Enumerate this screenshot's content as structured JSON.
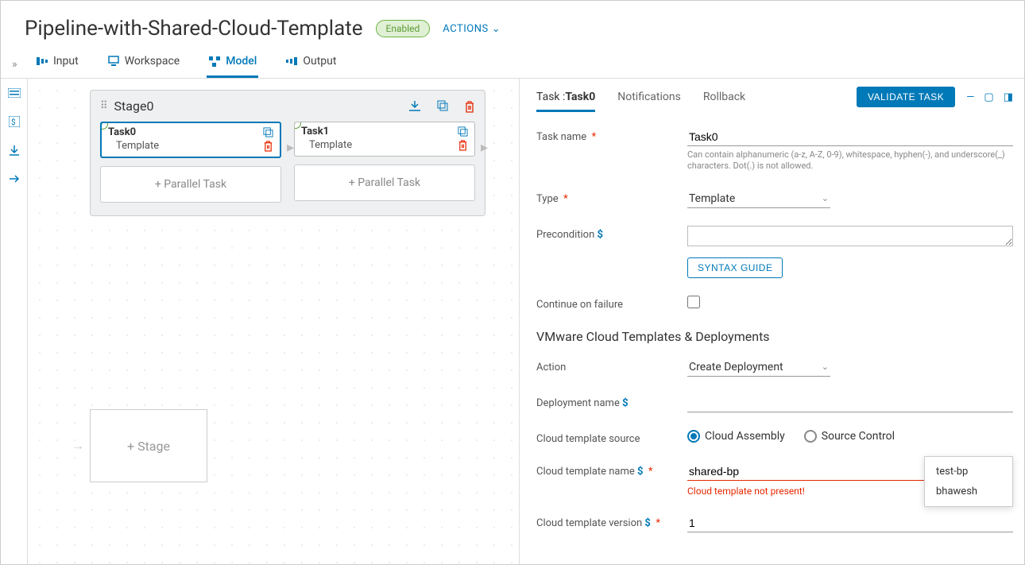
{
  "header": {
    "title": "Pipeline-with-Shared-Cloud-Template",
    "status": "Enabled",
    "actions": "ACTIONS"
  },
  "tabs": {
    "input": "Input",
    "workspace": "Workspace",
    "model": "Model",
    "output": "Output"
  },
  "stage": {
    "name": "Stage0",
    "tasks": [
      {
        "name": "Task0",
        "type": "Template"
      },
      {
        "name": "Task1",
        "type": "Template"
      }
    ],
    "parallel_label": "+ Parallel Task"
  },
  "add_stage": "+ Stage",
  "panel": {
    "tabs": {
      "task_prefix": "Task :",
      "task_name": "Task0",
      "notifications": "Notifications",
      "rollback": "Rollback"
    },
    "validate": "VALIDATE TASK",
    "form": {
      "task_name_label": "Task name",
      "task_name_value": "Task0",
      "task_name_hint": "Can contain alphanumeric (a-z, A-Z, 0-9), whitespace, hyphen(-), and underscore(_) characters. Dot(.) is not allowed.",
      "type_label": "Type",
      "type_value": "Template",
      "precondition_label": "Precondition",
      "syntax_guide": "SYNTAX GUIDE",
      "continue_label": "Continue on failure",
      "section_title": "VMware Cloud Templates & Deployments",
      "action_label": "Action",
      "action_value": "Create Deployment",
      "deploy_name_label": "Deployment name",
      "source_label": "Cloud template source",
      "source_opt1": "Cloud Assembly",
      "source_opt2": "Source Control",
      "template_name_label": "Cloud template name",
      "template_name_value": "shared-bp",
      "template_error": "Cloud template not present!",
      "template_version_label": "Cloud template version",
      "template_version_value": "1"
    },
    "popup": {
      "item1": "test-bp",
      "item2": "bhawesh"
    }
  }
}
